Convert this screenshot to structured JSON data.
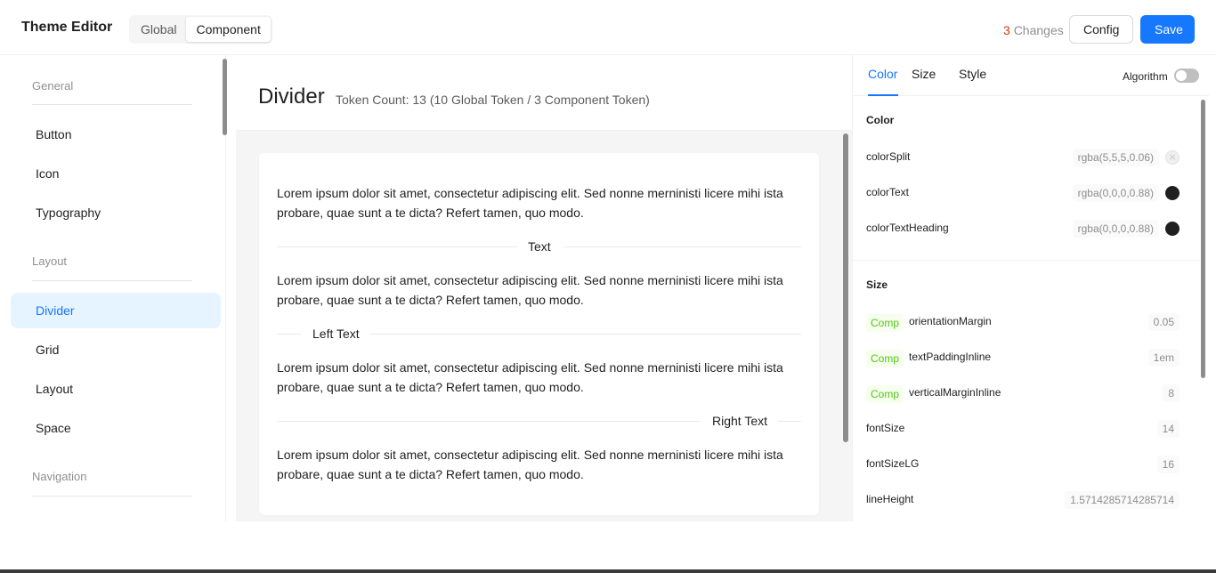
{
  "header": {
    "app_title": "Theme Editor",
    "segmented": [
      "Global",
      "Component"
    ],
    "segmented_selected": "Component",
    "changes_count": "3",
    "changes_label": "Changes",
    "config_label": "Config",
    "save_label": "Save"
  },
  "sidebar": {
    "groups": [
      {
        "title": "General",
        "items": [
          "Button",
          "Icon",
          "Typography"
        ]
      },
      {
        "title": "Layout",
        "items": [
          "Divider",
          "Grid",
          "Layout",
          "Space"
        ]
      },
      {
        "title": "Navigation",
        "items": []
      }
    ],
    "selected": "Divider"
  },
  "main": {
    "component_title": "Divider",
    "token_count": "Token Count: 13 (10 Global Token / 3 Component Token)",
    "paragraph": "Lorem ipsum dolor sit amet, consectetur adipiscing elit. Sed nonne merninisti licere mihi ista probare, quae sunt a te dicta? Refert tamen, quo modo.",
    "dividers": {
      "center": "Text",
      "left": "Left Text",
      "right": "Right Text"
    }
  },
  "panel": {
    "tabs": [
      "Color",
      "Size",
      "Style"
    ],
    "active_tab": "Color",
    "algorithm_label": "Algorithm",
    "algorithm_on": false,
    "color_section": {
      "title": "Color",
      "tokens": [
        {
          "name": "colorSplit",
          "value": "rgba(5,5,5,0.06)",
          "swatch": "#f0f0f0"
        },
        {
          "name": "colorText",
          "value": "rgba(0,0,0,0.88)",
          "swatch": "#1f1f1f"
        },
        {
          "name": "colorTextHeading",
          "value": "rgba(0,0,0,0.88)",
          "swatch": "#1f1f1f"
        }
      ]
    },
    "size_section": {
      "title": "Size",
      "comp_tag": "Comp",
      "tokens": [
        {
          "name": "orientationMargin",
          "value": "0.05",
          "component": true
        },
        {
          "name": "textPaddingInline",
          "value": "1em",
          "component": true
        },
        {
          "name": "verticalMarginInline",
          "value": "8",
          "component": true
        },
        {
          "name": "fontSize",
          "value": "14",
          "component": false
        },
        {
          "name": "fontSizeLG",
          "value": "16",
          "component": false
        },
        {
          "name": "lineHeight",
          "value": "1.5714285714285714",
          "component": false
        }
      ]
    }
  },
  "colors": {
    "primary": "#1677ff",
    "selected_bg": "#e6f4ff",
    "changes": "#d4380d",
    "comp_tag": "#52c41a"
  }
}
